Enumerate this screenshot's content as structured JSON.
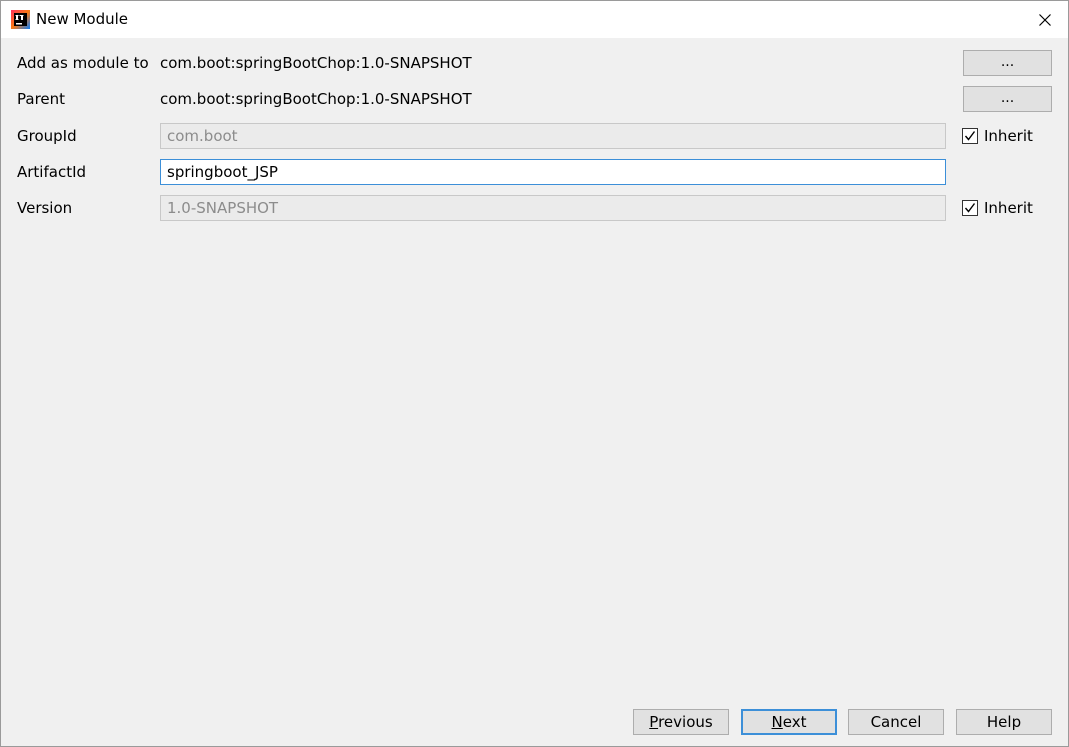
{
  "window": {
    "title": "New Module",
    "close_icon": "close-icon"
  },
  "form": {
    "add_as_module_to": {
      "label": "Add as module to",
      "value": "com.boot:springBootChop:1.0-SNAPSHOT",
      "button": "..."
    },
    "parent": {
      "label": "Parent",
      "value": "com.boot:springBootChop:1.0-SNAPSHOT",
      "button": "..."
    },
    "group_id": {
      "label": "GroupId",
      "value": "com.boot",
      "inherit_label": "Inherit",
      "inherit_checked": true
    },
    "artifact_id": {
      "label": "ArtifactId",
      "value": "springboot_JSP"
    },
    "version": {
      "label": "Version",
      "value": "1.0-SNAPSHOT",
      "inherit_label": "Inherit",
      "inherit_checked": true
    }
  },
  "buttons": {
    "previous_mnemonic": "P",
    "previous_rest": "revious",
    "next_mnemonic": "N",
    "next_rest": "ext",
    "cancel": "Cancel",
    "help": "Help"
  },
  "colors": {
    "accent": "#3c8fd8",
    "background": "#f0f0f0"
  }
}
